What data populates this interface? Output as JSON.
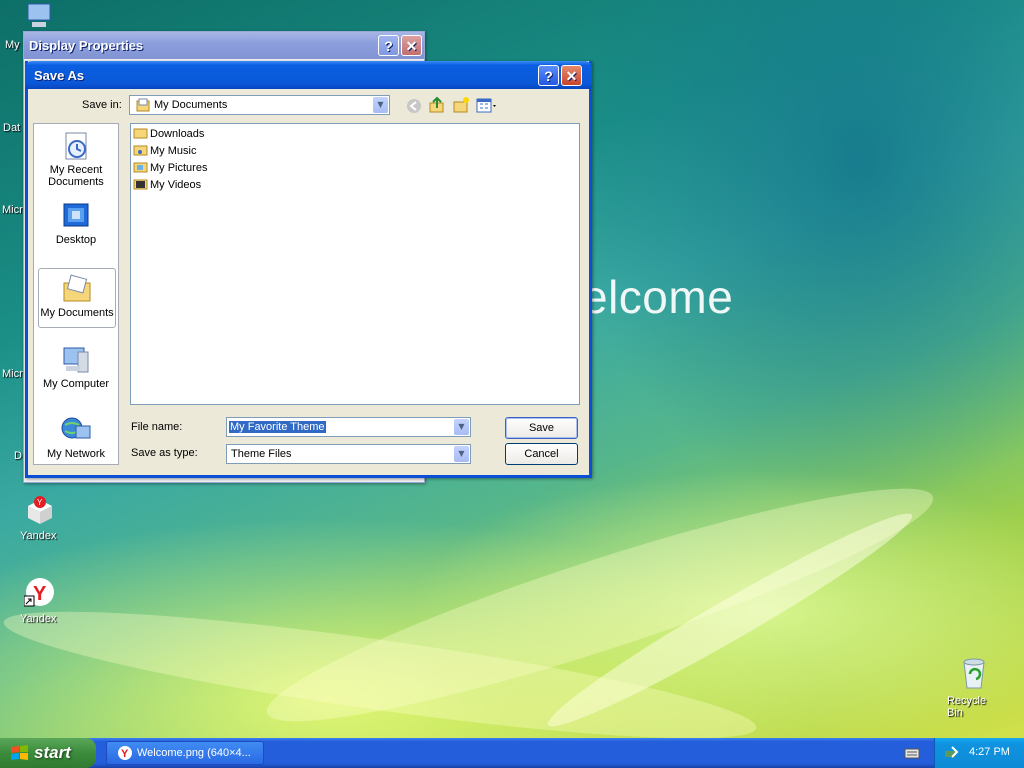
{
  "desktop": {
    "welcome_text": "elcome",
    "icons_left_partial": [
      "My",
      "Dat",
      "Micro C",
      "Micro B",
      "D"
    ],
    "yandex1_label": "Yandex",
    "yandex2_label": "Yandex",
    "recycle_label": "Recycle Bin"
  },
  "display_props": {
    "title": "Display Properties",
    "help": "?",
    "close": "✕"
  },
  "save_as": {
    "title": "Save As",
    "help": "?",
    "close": "✕",
    "save_in_label": "Save in:",
    "save_in_value": "My Documents",
    "places": [
      {
        "label1": "My Recent",
        "label2": "Documents"
      },
      {
        "label1": "Desktop",
        "label2": ""
      },
      {
        "label1": "My Documents",
        "label2": ""
      },
      {
        "label1": "My Computer",
        "label2": ""
      },
      {
        "label1": "My Network",
        "label2": ""
      }
    ],
    "files": [
      "Downloads",
      "My Music",
      "My Pictures",
      "My Videos"
    ],
    "file_name_label": "File name:",
    "file_name_value": "My Favorite Theme",
    "save_as_type_label": "Save as type:",
    "save_as_type_value": "Theme Files",
    "save_button": "Save",
    "cancel_button": "Cancel"
  },
  "taskbar": {
    "start_label": "start",
    "task_label": "Welcome.png (640×4...",
    "clock": "4:27 PM"
  },
  "colors": {
    "titlebar": "#0a5fe0",
    "selection": "#316ac5"
  }
}
